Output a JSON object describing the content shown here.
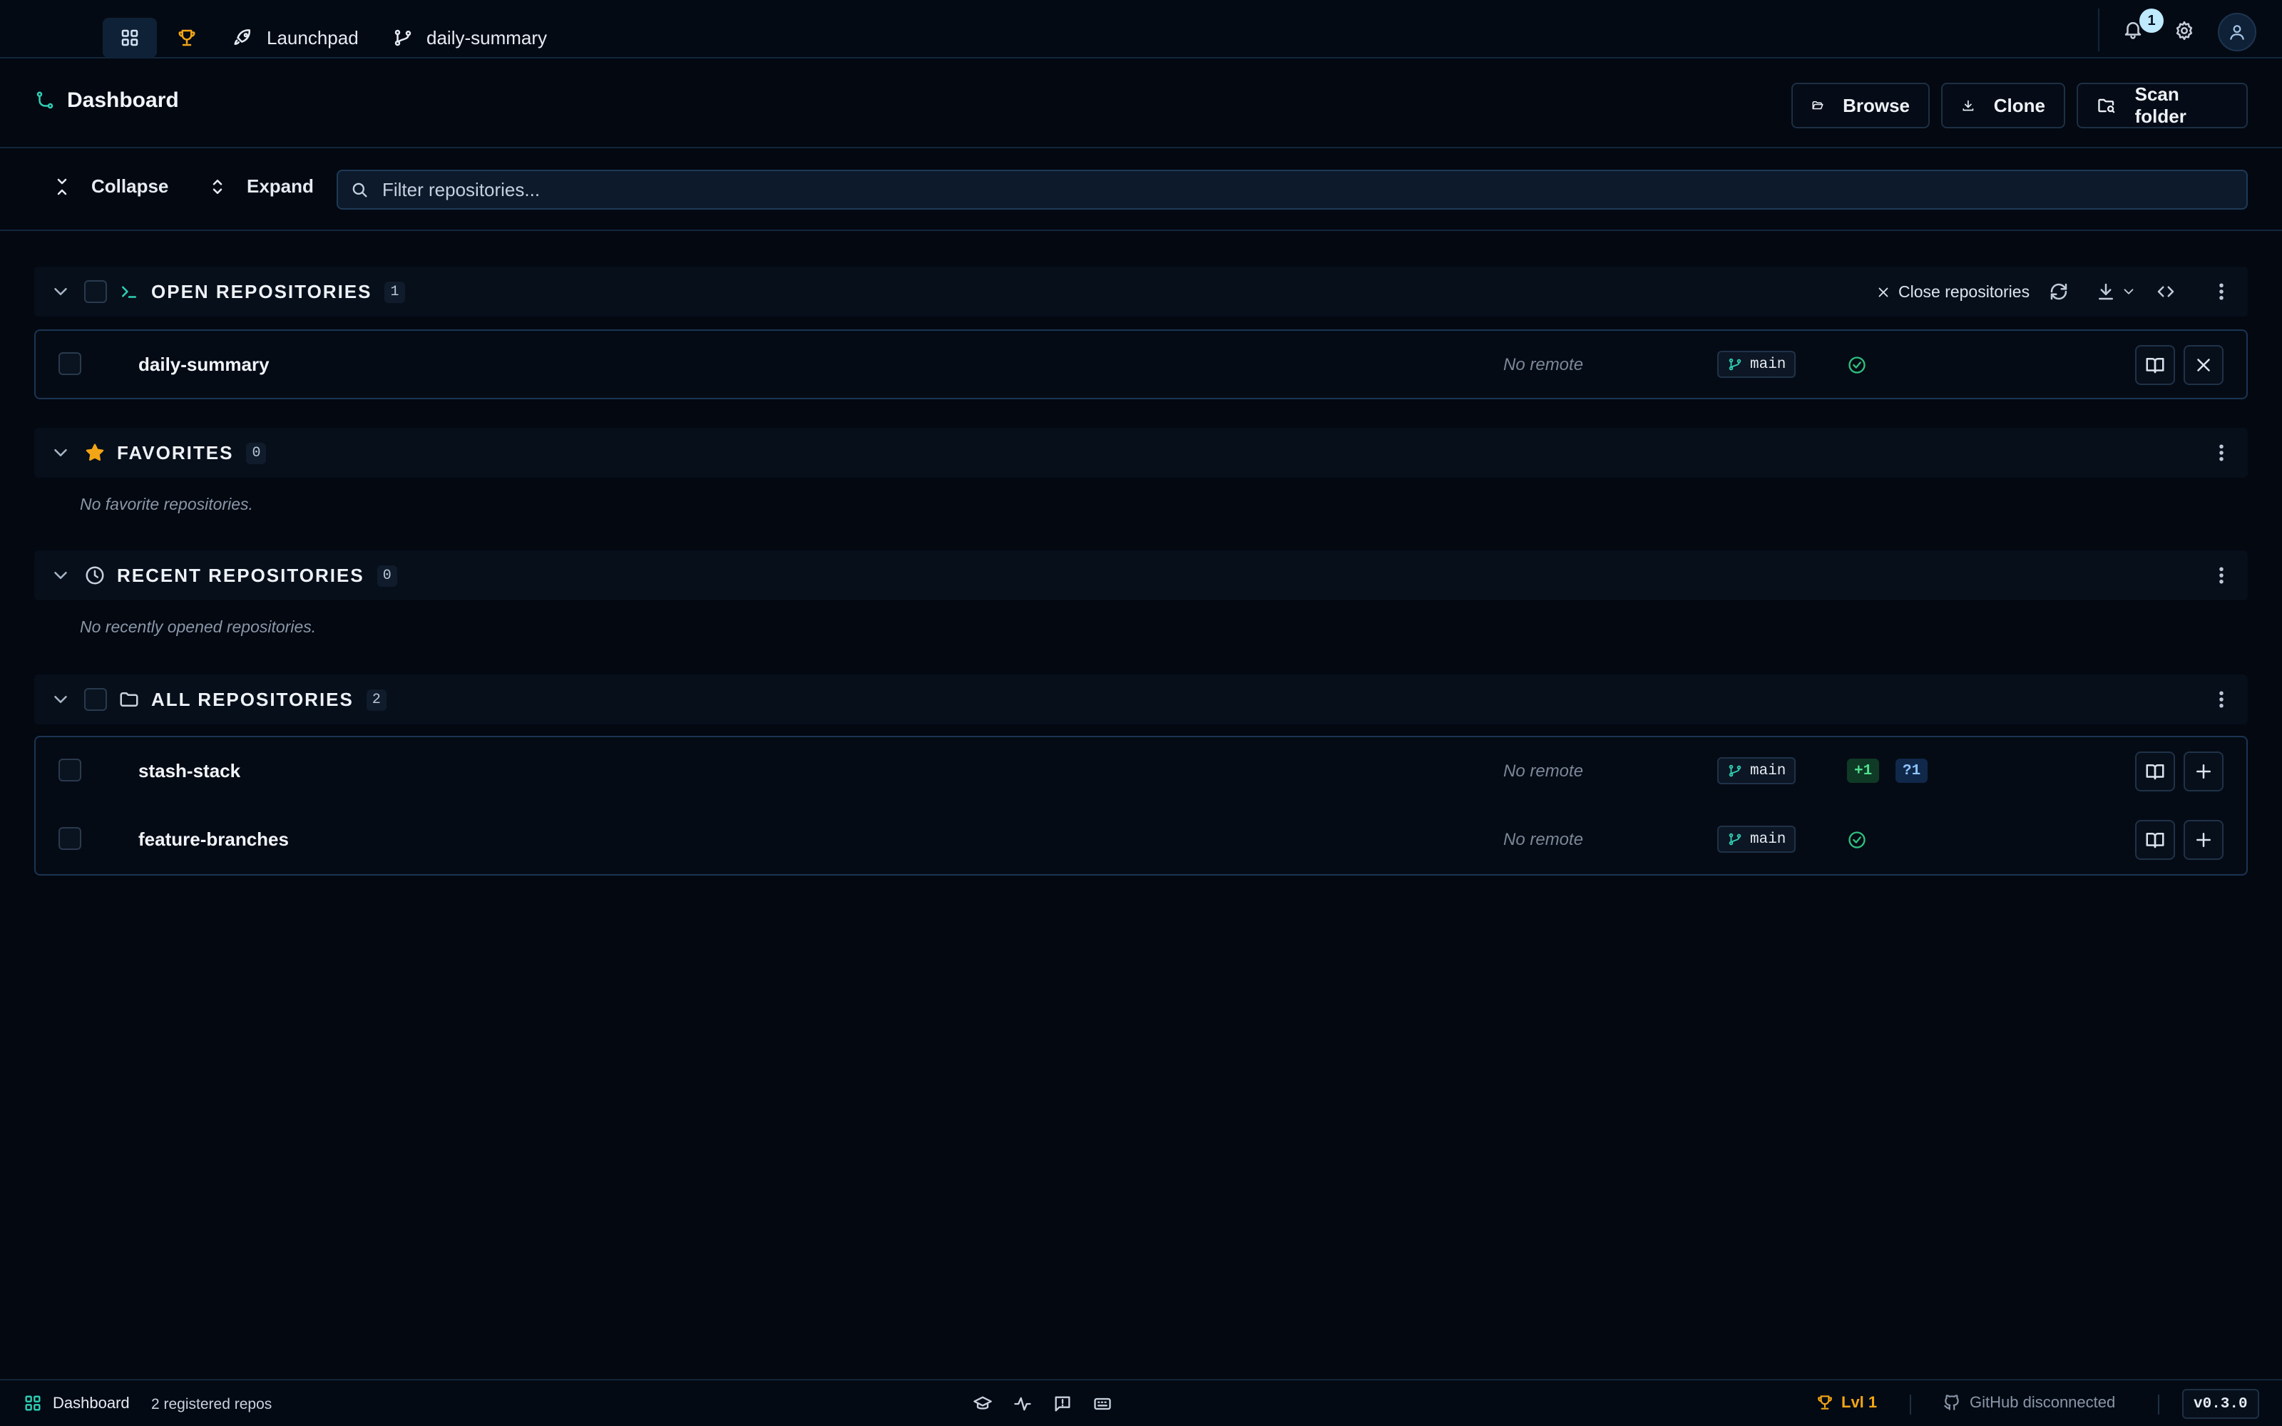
{
  "topbar": {
    "tabs": [
      {
        "icon": "dashboard-grid-icon"
      },
      {
        "icon": "trophy-icon"
      },
      {
        "label": "Launchpad",
        "icon": "rocket-icon"
      },
      {
        "label": "daily-summary",
        "icon": "git-branch-icon"
      }
    ],
    "notification_count": "1"
  },
  "header": {
    "title": "Dashboard",
    "buttons": {
      "browse": "Browse",
      "clone": "Clone",
      "scan": "Scan folder"
    }
  },
  "toolbar": {
    "collapse": "Collapse",
    "expand": "Expand",
    "filter_placeholder": "Filter repositories..."
  },
  "sections": {
    "open": {
      "title": "OPEN REPOSITORIES",
      "count": "1",
      "close_label": "Close repositories",
      "repos": [
        {
          "name": "daily-summary",
          "remote": "No remote",
          "branch": "main",
          "status": "clean"
        }
      ]
    },
    "favorites": {
      "title": "FAVORITES",
      "count": "0",
      "empty": "No favorite repositories."
    },
    "recent": {
      "title": "RECENT REPOSITORIES",
      "count": "0",
      "empty": "No recently opened repositories."
    },
    "all": {
      "title": "ALL REPOSITORIES",
      "count": "2",
      "repos": [
        {
          "name": "stash-stack",
          "remote": "No remote",
          "branch": "main",
          "added": "+1",
          "untracked": "?1"
        },
        {
          "name": "feature-branches",
          "remote": "No remote",
          "branch": "main",
          "status": "clean"
        }
      ]
    }
  },
  "statusbar": {
    "view": "Dashboard",
    "repos": "2 registered repos",
    "level": "Lvl 1",
    "github": "GitHub disconnected",
    "version": "v0.3.0"
  },
  "colors": {
    "background": "#030811",
    "accent_teal": "#2fd0b5",
    "accent_orange": "#f2a516",
    "success_green": "#2fc07f"
  }
}
